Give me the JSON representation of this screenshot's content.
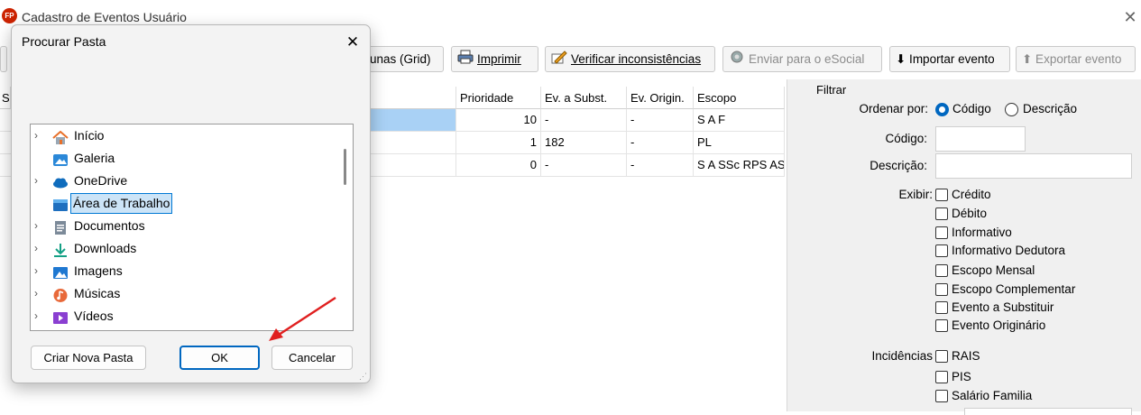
{
  "window": {
    "title": "Cadastro de Eventos Usuário",
    "app_icon_text": "FP",
    "accent": "#0067c0",
    "arrow_color": "#e02020"
  },
  "toolbar": {
    "columns_grid": "lunas (Grid)",
    "print": "Imprimir",
    "verify": "Verificar inconsistências",
    "send_esocial": "Enviar para o eSocial",
    "import_event": "⬇ Importar evento",
    "export_event": "⬆ Exportar evento"
  },
  "grid": {
    "col_first": "Se",
    "headers": {
      "prioridade": "Prioridade",
      "ev_subst": "Ev. a Subst.",
      "ev_origin": "Ev. Origin.",
      "escopo": "Escopo"
    },
    "rows": [
      {
        "prioridade": "10",
        "ev_subst": "-",
        "ev_origin": "-",
        "escopo": "S A F"
      },
      {
        "prioridade": "1",
        "ev_subst": "182",
        "ev_origin": "-",
        "escopo": "PL"
      },
      {
        "prioridade": "0",
        "ev_subst": "-",
        "ev_origin": "-",
        "escopo": "S A SSc RPS AS"
      }
    ]
  },
  "filter": {
    "title": "Filtrar",
    "order_label": "Ordenar por:",
    "order_options": [
      {
        "label": "Código",
        "selected": true
      },
      {
        "label": "Descrição",
        "selected": false
      }
    ],
    "code_label": "Código:",
    "code_value": "",
    "desc_label": "Descrição:",
    "desc_value": "",
    "show_label": "Exibir:",
    "show_options": [
      "Crédito",
      "Débito",
      "Informativo",
      "Informativo Dedutora",
      "Escopo Mensal",
      "Escopo Complementar",
      "Evento a Substituir",
      "Evento Originário"
    ],
    "incid_label": "Incidências",
    "incid_options": [
      "RAIS",
      "PIS",
      "Salário Familia"
    ]
  },
  "dialog": {
    "title": "Procurar Pasta",
    "tree": [
      {
        "label": "Início",
        "icon": "home-icon",
        "expandable": true,
        "selected": false
      },
      {
        "label": "Galeria",
        "icon": "gallery-icon",
        "expandable": false,
        "selected": false
      },
      {
        "label": "OneDrive",
        "icon": "cloud-icon",
        "expandable": true,
        "selected": false
      },
      {
        "label": "Área de Trabalho",
        "icon": "desktop-icon",
        "expandable": false,
        "selected": true
      },
      {
        "label": "Documentos",
        "icon": "documents-icon",
        "expandable": true,
        "selected": false
      },
      {
        "label": "Downloads",
        "icon": "download-icon",
        "expandable": true,
        "selected": false
      },
      {
        "label": "Imagens",
        "icon": "pictures-icon",
        "expandable": true,
        "selected": false
      },
      {
        "label": "Músicas",
        "icon": "music-icon",
        "expandable": true,
        "selected": false
      },
      {
        "label": "Vídeos",
        "icon": "video-icon",
        "expandable": true,
        "selected": false
      }
    ],
    "new_folder": "Criar Nova Pasta",
    "ok": "OK",
    "cancel": "Cancelar"
  }
}
